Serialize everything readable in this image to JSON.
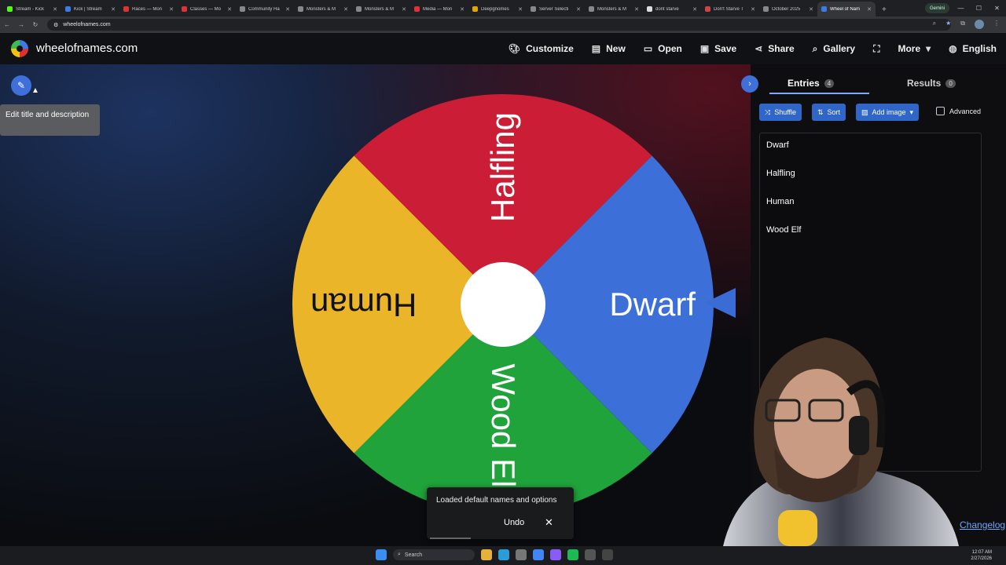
{
  "browser": {
    "tabs": [
      {
        "label": "Stream - Kick",
        "color": "#53fc18"
      },
      {
        "label": "Kick | Stream",
        "color": "#3d7be0"
      },
      {
        "label": "Races — Mon",
        "color": "#d33"
      },
      {
        "label": "Classes — Mo",
        "color": "#d33"
      },
      {
        "label": "Community Ha",
        "color": "#888"
      },
      {
        "label": "Monsters & M",
        "color": "#888"
      },
      {
        "label": "Monsters & M",
        "color": "#888"
      },
      {
        "label": "Media — Mon",
        "color": "#d33"
      },
      {
        "label": "Deepgnomes",
        "color": "#e5a400"
      },
      {
        "label": "Server Selecti",
        "color": "#888"
      },
      {
        "label": "Monsters & M",
        "color": "#888"
      },
      {
        "label": "dont starve",
        "color": "#ddd"
      },
      {
        "label": "Don't Starve T",
        "color": "#c44"
      },
      {
        "label": "October 2025",
        "color": "#888"
      },
      {
        "label": "Wheel of Nam",
        "color": "#3d7be0",
        "active": true
      }
    ],
    "gemini_label": "Gemini",
    "url": "wheelofnames.com"
  },
  "site": {
    "name": "wheelofnames.com",
    "menu": {
      "customize": "Customize",
      "new": "New",
      "open": "Open",
      "save": "Save",
      "share": "Share",
      "gallery": "Gallery",
      "more": "More",
      "language": "English"
    }
  },
  "tooltip": "Edit title and description",
  "wheel": {
    "segments": [
      {
        "label": "Dwarf",
        "color": "#3d6fd9"
      },
      {
        "label": "Wood Elf",
        "color": "#1fa33a"
      },
      {
        "label": "Human",
        "color": "#ebb52a"
      },
      {
        "label": "Halfling",
        "color": "#cc1d36"
      }
    ]
  },
  "toast": {
    "message": "Loaded default names and options",
    "undo": "Undo",
    "close": "✕"
  },
  "panel": {
    "entries_tab": "Entries",
    "entries_count": "4",
    "results_tab": "Results",
    "results_count": "0",
    "shuffle": "Shuffle",
    "sort": "Sort",
    "add_image": "Add image",
    "advanced": "Advanced",
    "entries": [
      "Dwarf",
      "Halfling",
      "Human",
      "Wood Elf"
    ],
    "changelog": "Changelog"
  },
  "taskbar": {
    "search": "Search",
    "time": "12:07 AM",
    "date": "2/27/2026"
  }
}
